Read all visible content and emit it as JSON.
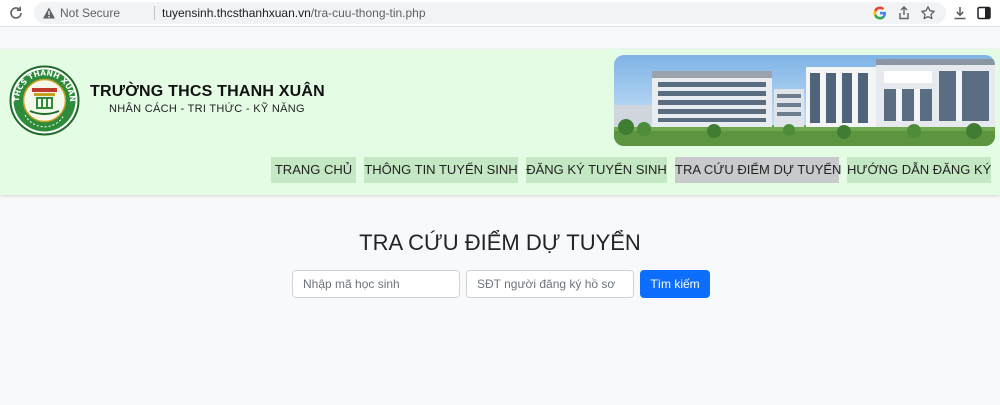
{
  "browser": {
    "security_label": "Not Secure",
    "url_domain": "tuyensinh.thcsthanhxuan.vn",
    "url_path": "/tra-cuu-thong-tin.php"
  },
  "header": {
    "school_name": "TRƯỜNG THCS THANH XUÂN",
    "motto": "NHÂN CÁCH - TRI THỨC - KỸ NĂNG",
    "logo_text": "THCS THANH XUÂN",
    "nav": [
      {
        "label": "TRANG CHỦ",
        "active": false
      },
      {
        "label": "THÔNG TIN TUYỂN SINH",
        "active": false
      },
      {
        "label": "ĐĂNG KÝ TUYỂN SINH",
        "active": false
      },
      {
        "label": "TRA CỨU ĐIỂM DỰ TUYỂN",
        "active": true
      },
      {
        "label": "HƯỚNG DẪN ĐĂNG KÝ",
        "active": false
      }
    ]
  },
  "main": {
    "title": "TRA CỨU ĐIỂM DỰ TUYỂN",
    "student_code": {
      "value": "",
      "placeholder": "Nhập mã học sinh"
    },
    "phone": {
      "value": "",
      "placeholder": "SĐT người đăng ký hồ sơ"
    },
    "search_label": "Tìm kiếm"
  },
  "colors": {
    "header_bg": "#e4fce4",
    "nav_bg": "#c4e8c4",
    "nav_active_bg": "#c9cacb",
    "button_primary": "#0d6efd"
  }
}
